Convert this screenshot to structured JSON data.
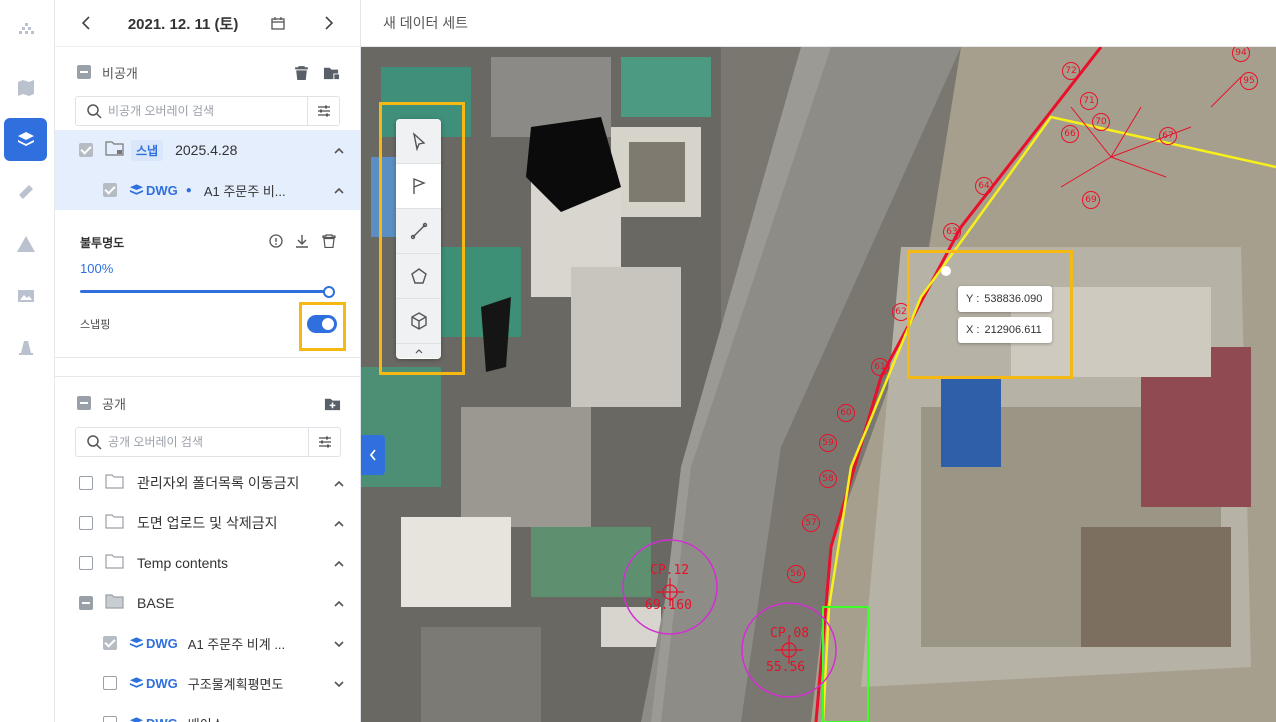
{
  "topbar": {
    "title": "새 데이터 세트"
  },
  "date_bar": {
    "date": "2021. 12. 11 (토)"
  },
  "private_section": {
    "title": "비공개",
    "search_placeholder": "비공개 오버레이 검색",
    "snap_group": {
      "badge": "스냅",
      "label": "2025.4.28"
    },
    "dwg_item": {
      "type": "DWG",
      "label": "A1 주문주 비..."
    },
    "opacity": {
      "label": "불투명도",
      "value": "100%",
      "level": 1.0
    },
    "snapping": {
      "label": "스냅핑",
      "enabled": true
    }
  },
  "public_section": {
    "title": "공개",
    "search_placeholder": "공개 오버레이 검색",
    "folders": [
      {
        "label": "관리자외 폴더목록 이동금지",
        "checked": false
      },
      {
        "label": "도면 업로드 및 삭제금지",
        "checked": false
      },
      {
        "label": "Temp contents",
        "checked": false
      },
      {
        "label": "BASE",
        "checked": "partial"
      }
    ],
    "base_items": [
      {
        "type": "DWG",
        "label": "A1 주문주 비계 ...",
        "checked": true
      },
      {
        "type": "DWG",
        "label": "구조물계획평면도",
        "checked": false
      },
      {
        "type": "DWG",
        "label": "배이스",
        "checked": false
      }
    ]
  },
  "map": {
    "coord_y": {
      "label": "Y :",
      "value": "538836.090"
    },
    "coord_x": {
      "label": "X :",
      "value": "212906.611"
    },
    "markers": [
      "64",
      "63",
      "62",
      "61",
      "60",
      "59",
      "58",
      "57",
      "56",
      "66",
      "67",
      "69",
      "70",
      "71",
      "72",
      "94",
      "95"
    ],
    "cp_markers": [
      {
        "name": "CP.12",
        "value": "69.160"
      },
      {
        "name": "CP.08",
        "value": "55.56"
      }
    ]
  },
  "colors": {
    "accent": "#2f6fde",
    "highlight": "#f6b913",
    "red_line": "#e8102a",
    "yellow_line": "#f7f01a"
  }
}
